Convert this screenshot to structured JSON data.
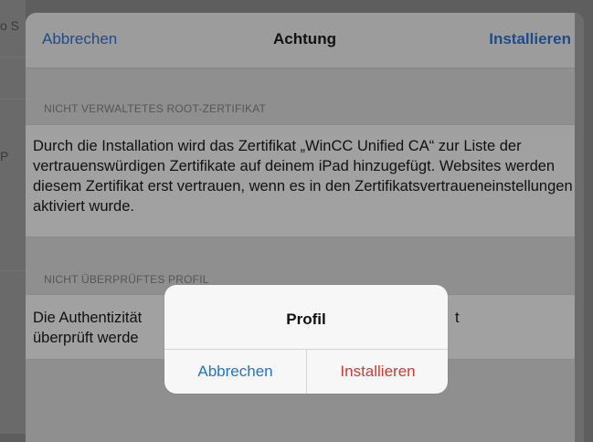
{
  "background": {
    "left_fragments": [
      "o S",
      "P"
    ]
  },
  "navbar": {
    "cancel_label": "Abbrechen",
    "title": "Achtung",
    "install_label": "Installieren"
  },
  "sections": [
    {
      "header": "NICHT VERWALTETES ROOT-ZERTIFIKAT",
      "text": "Durch die Installation wird das Zertifikat „WinCC Unified CA“ zur Liste der vertrauenswürdigen Zertifikate auf deinem iPad hinzugefügt. Websites werden diesem Zertifikat erst vertrauen, wenn es in den Zertifikatsvertraueneinstellungen aktiviert wurde."
    },
    {
      "header": "NICHT ÜBERPRÜFTES PROFIL",
      "text_left_line1": "Die Authentizität",
      "text_left_line2": "überprüft werde",
      "text_right_fragment": "t"
    }
  ],
  "alert": {
    "title": "Profil",
    "cancel_label": "Abbrechen",
    "install_label": "Installieren"
  },
  "colors": {
    "link_blue": "#1d74d8",
    "destructive_red": "#e0342e",
    "nav_link_dimmed": "#1c4c8c"
  }
}
